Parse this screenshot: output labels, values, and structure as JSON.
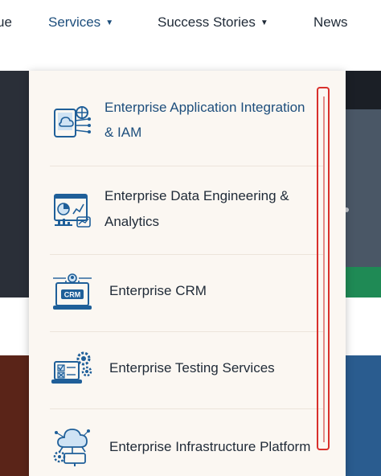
{
  "nav": {
    "items": [
      {
        "label": "ue",
        "caret": ""
      },
      {
        "label": "Services",
        "caret": "▼"
      },
      {
        "label": "Success Stories",
        "caret": "▼"
      },
      {
        "label": "News",
        "caret": ""
      }
    ]
  },
  "dropdown": {
    "items": [
      {
        "line1": "Enterprise Application Integration",
        "line2": "& IAM",
        "icon": "cloud-network-icon"
      },
      {
        "line1": "Enterprise Data Engineering &",
        "line2": "Analytics",
        "icon": "analytics-dashboard-icon"
      },
      {
        "line1": "Enterprise CRM",
        "line2": "",
        "icon": "crm-icon"
      },
      {
        "line1": "Enterprise Testing Services",
        "line2": "",
        "icon": "testing-icon"
      },
      {
        "line1": "Enterprise Infrastructure Platform",
        "line2": "",
        "icon": "infrastructure-icon"
      }
    ]
  },
  "colors": {
    "accent": "#1d4e7c",
    "icon_blue": "#1f5f99",
    "highlight": "#d9302c",
    "dropdown_bg": "#fbf7f2"
  }
}
